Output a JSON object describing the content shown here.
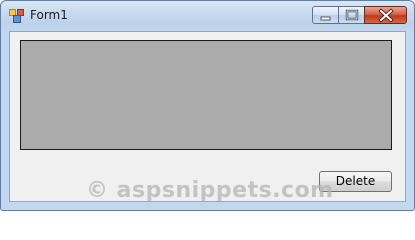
{
  "window": {
    "title": "Form1",
    "icon": "winforms-app-icon"
  },
  "controls": {
    "minimize_icon": "minimize-icon",
    "maximize_icon": "maximize-icon",
    "close_icon": "close-icon"
  },
  "grid": {
    "columns": [],
    "rows": []
  },
  "buttons": {
    "delete_label": "Delete"
  },
  "watermark": "© aspsnippets.com",
  "colors": {
    "grid_background": "#ababab",
    "form_background": "#f0f0f0",
    "close_button": "#c2371b"
  }
}
